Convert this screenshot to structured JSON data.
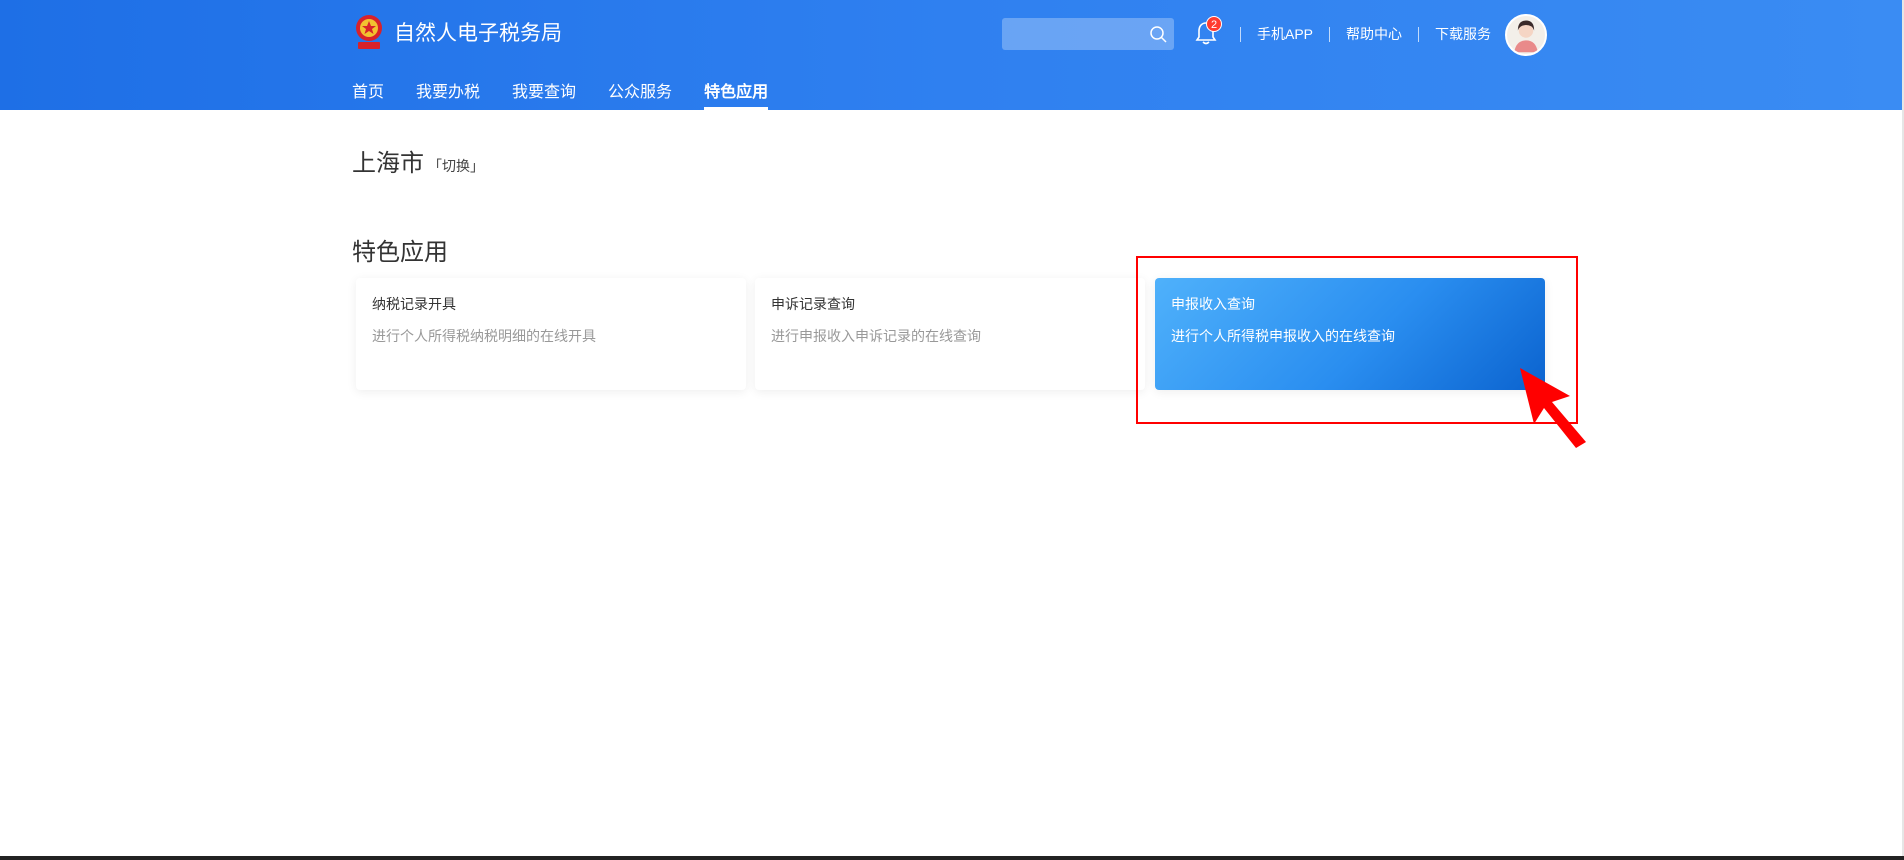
{
  "header": {
    "logo_text": "自然人电子税务局",
    "notification_count": "2",
    "links": [
      "手机APP",
      "帮助中心",
      "下载服务"
    ],
    "search_placeholder": ""
  },
  "nav": {
    "items": [
      "首页",
      "我要办税",
      "我要查询",
      "公众服务",
      "特色应用"
    ],
    "active_index": 4
  },
  "city": {
    "name": "上海市",
    "switch_label": "「切换」"
  },
  "section": {
    "title": "特色应用"
  },
  "cards": [
    {
      "title": "纳税记录开具",
      "desc": "进行个人所得税纳税明细的在线开具"
    },
    {
      "title": "申诉记录查询",
      "desc": "进行申报收入申诉记录的在线查询"
    },
    {
      "title": "申报收入查询",
      "desc": "进行个人所得税申报收入的在线查询"
    }
  ],
  "colors": {
    "header_start": "#1e6fe6",
    "header_end": "#3a8cf3",
    "highlight": "#ff0000",
    "card_gradient_start": "#4fb1fb",
    "card_gradient_end": "#0b63cf"
  }
}
